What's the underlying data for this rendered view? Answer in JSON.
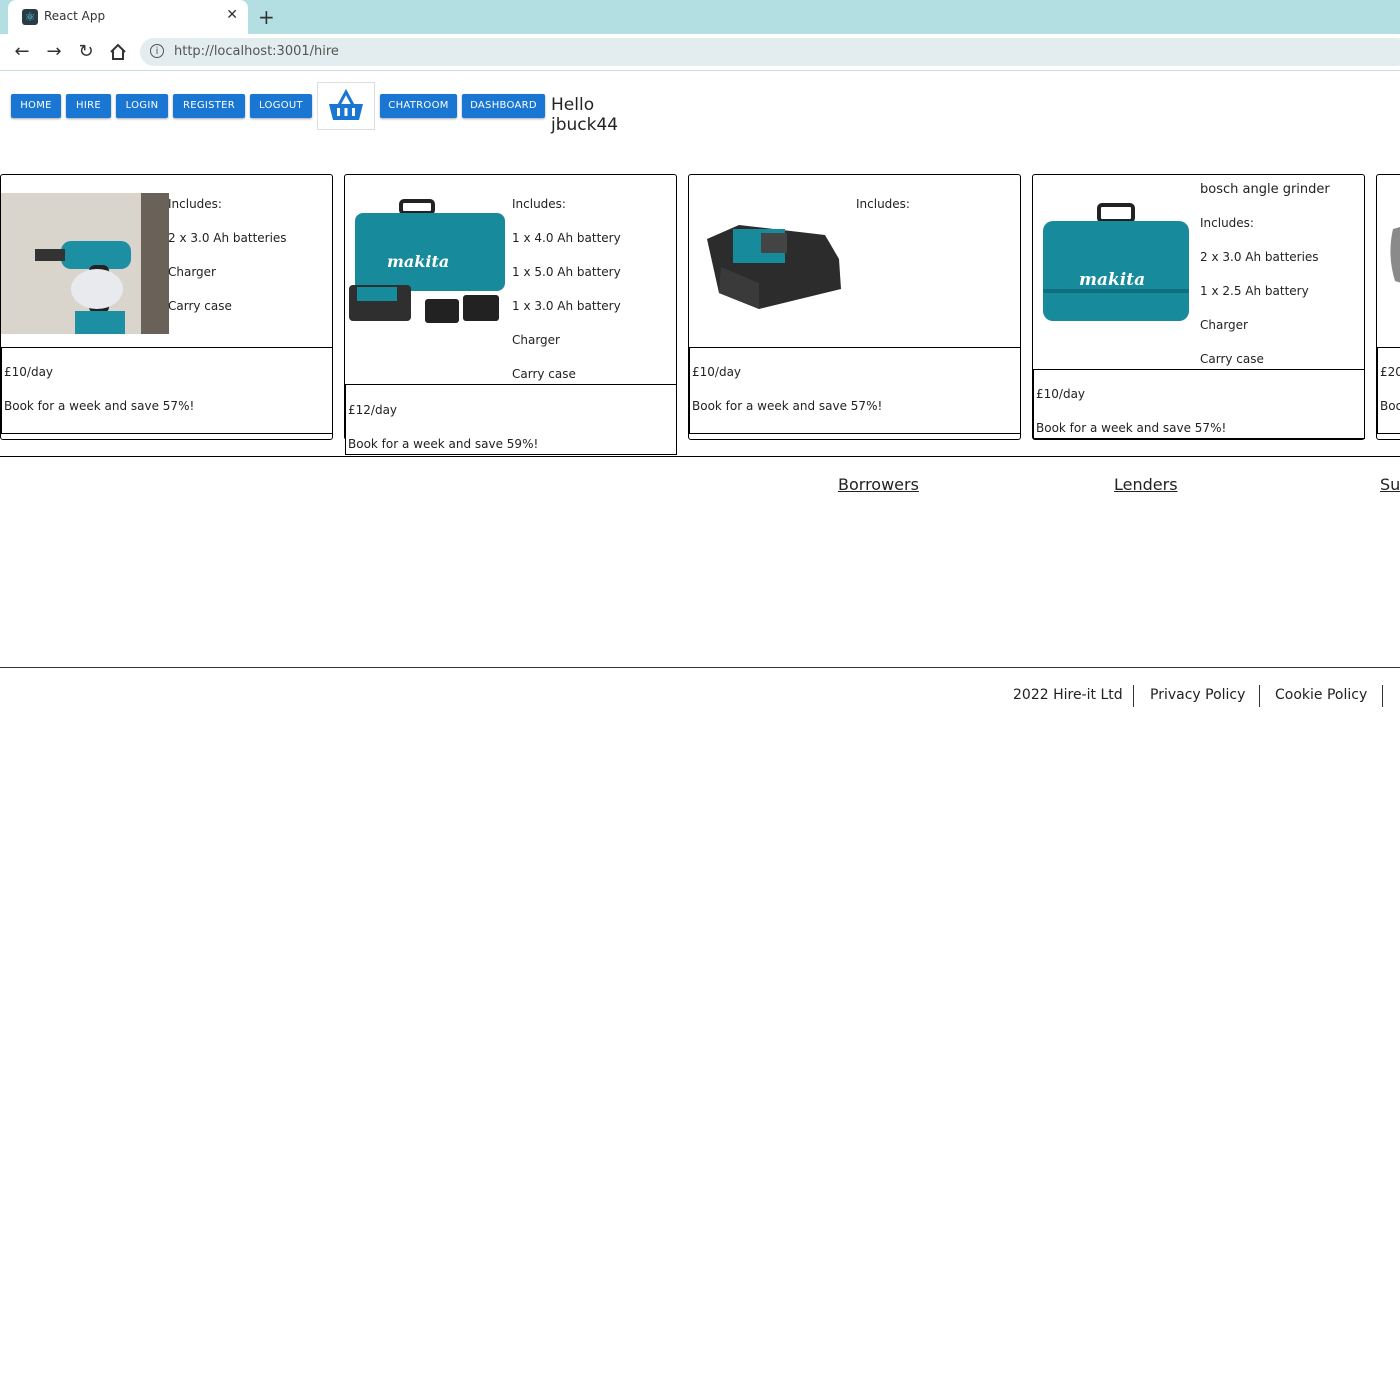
{
  "browser": {
    "tab_title": "React App",
    "url": "http://localhost:3001/hire"
  },
  "nav": {
    "home": "HOME",
    "hire": "HIRE",
    "login": "LOGIN",
    "register": "REGISTER",
    "logout": "LOGOUT",
    "chatroom": "CHATROOM",
    "dashboard": "DASHBOARD",
    "greeting": "Hello jbuck44",
    "accent": "#1976d2"
  },
  "products": [
    {
      "title": "",
      "includes": [
        "Includes:",
        "2 x 3.0 Ah batteries",
        "Charger",
        "Carry case"
      ],
      "price": "£10/day",
      "deal": "Book for a week and save 57%!"
    },
    {
      "title": "",
      "includes": [
        "Includes:",
        "1 x 4.0 Ah battery",
        "1 x 5.0 Ah battery",
        "1 x 3.0 Ah battery",
        "Charger",
        "Carry case"
      ],
      "price": "£12/day",
      "deal": "Book for a week and save 59%!"
    },
    {
      "title": "",
      "includes": [
        "Includes:"
      ],
      "price": "£10/day",
      "deal": "Book for a week and save 57%!"
    },
    {
      "title": "bosch angle grinder",
      "includes": [
        "Includes:",
        "2 x 3.0 Ah batteries",
        "1 x 2.5 Ah battery",
        "Charger",
        "Carry case"
      ],
      "price": "£10/day",
      "deal": "Book for a week and save 57%!"
    },
    {
      "title": "",
      "includes": [],
      "price": "£20",
      "deal": "Boo"
    }
  ],
  "links": {
    "borrowers": "Borrowers",
    "lenders": "Lenders",
    "su": "Su"
  },
  "footer": {
    "copyright": "2022 Hire-it Ltd",
    "privacy": "Privacy Policy",
    "cookie": "Cookie Policy"
  }
}
